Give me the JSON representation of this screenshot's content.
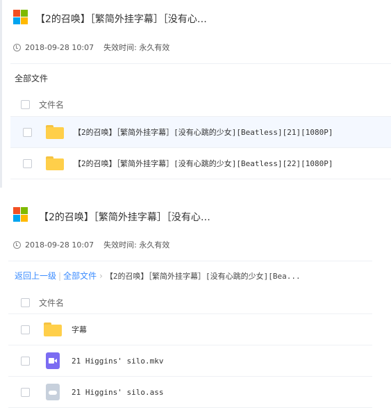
{
  "share_panel_1": {
    "title": "【2的召唤】［繁简外挂字幕］［没有心…",
    "timestamp": "2018-09-28 10:07",
    "expiry": "失效时间: 永久有效",
    "breadcrumb": "全部文件",
    "column_header": "文件名",
    "files": [
      {
        "name": "【2的召唤】［繁简外挂字幕］[没有心跳的少女][Beatless][21][1080P]",
        "icon": "folder-icon",
        "highlighted": true
      },
      {
        "name": "【2的召唤】［繁简外挂字幕］[没有心跳的少女][Beatless][22][1080P]",
        "icon": "folder-icon",
        "highlighted": false
      }
    ]
  },
  "share_panel_2": {
    "title": "【2的召唤】［繁简外挂字幕］［没有心…",
    "timestamp": "2018-09-28 10:07",
    "expiry": "失效时间: 永久有效",
    "breadcrumb": {
      "back": "返回上一级",
      "separator": "|",
      "all_files": "全部文件",
      "arrow": "›",
      "current": "【2的召唤】［繁简外挂字幕］[没有心跳的少女][Bea..."
    },
    "column_header": "文件名",
    "files": [
      {
        "name": "字幕",
        "icon": "folder-icon"
      },
      {
        "name": "21 Higgins' silo.mkv",
        "icon": "video-file-icon"
      },
      {
        "name": "21 Higgins' silo.ass",
        "icon": "generic-file-icon"
      }
    ]
  },
  "colors": {
    "link": "#3b8cff",
    "folder": "#ffcf4a",
    "video_icon": "#7b6cf2",
    "row_highlight": "#f4f8ff"
  }
}
